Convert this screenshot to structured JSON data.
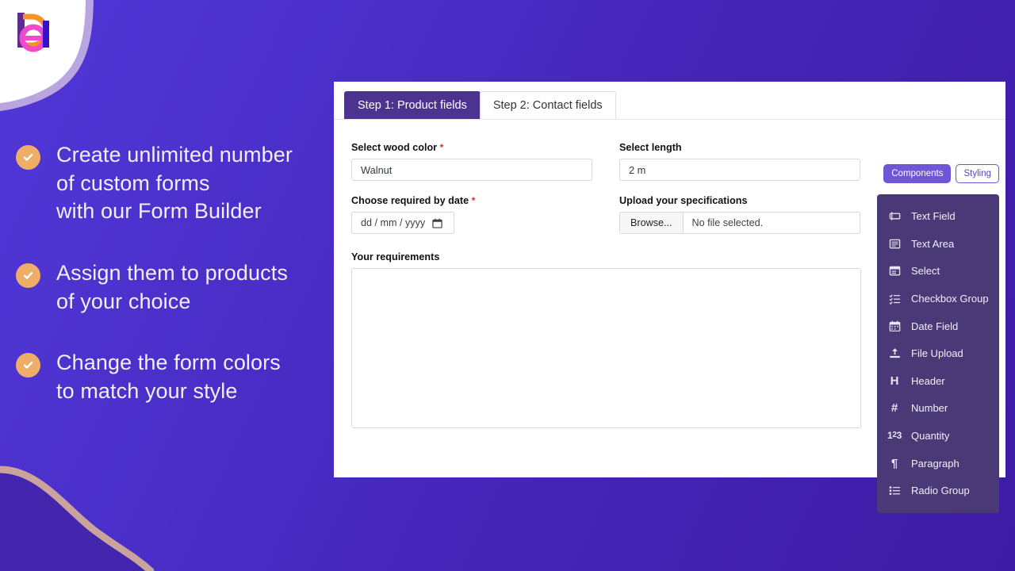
{
  "brand": {
    "logo_name": "delirium-logo",
    "colors": {
      "bg_gradient_start": "#5138d8",
      "bg_gradient_end": "#3d1ba4",
      "accent_orange": "#eeae67",
      "accent_purple": "#6f56d6",
      "panel_dark": "#493a77",
      "tab_active": "#4c3390",
      "required_red": "#d93025",
      "curve_tan": "#c9a39c",
      "curve_lavender": "#b9a5e0"
    }
  },
  "promo": {
    "bullets": [
      {
        "icon": "check-circle-icon",
        "text": "Create unlimited number\nof custom forms\nwith our Form Builder"
      },
      {
        "icon": "check-circle-icon",
        "text": "Assign them to products\nof your choice"
      },
      {
        "icon": "check-circle-icon",
        "text": "Change the form colors\nto match your style"
      }
    ]
  },
  "builder": {
    "tabs": [
      {
        "label": "Step 1: Product fields",
        "active": true
      },
      {
        "label": "Step 2: Contact fields",
        "active": false
      }
    ],
    "fields": {
      "wood_color": {
        "label": "Select wood color",
        "required": true,
        "required_mark": "*",
        "value": "Walnut"
      },
      "length": {
        "label": "Select length",
        "required": false,
        "value": "2 m"
      },
      "date": {
        "label": "Choose required by date",
        "required": true,
        "required_mark": "*",
        "placeholder": "dd / mm / yyyy",
        "icon": "calendar-icon"
      },
      "upload": {
        "label": "Upload your specifications",
        "required": false,
        "button_label": "Browse...",
        "file_status": "No file selected."
      },
      "requirements": {
        "label": "Your requirements",
        "required": false,
        "value": ""
      }
    },
    "rail": {
      "toggle": [
        {
          "label": "Components",
          "active": true
        },
        {
          "label": "Styling",
          "active": false
        }
      ],
      "components": [
        {
          "label": "Text Field",
          "icon": "text-field-icon"
        },
        {
          "label": "Text Area",
          "icon": "text-area-icon"
        },
        {
          "label": "Select",
          "icon": "select-icon"
        },
        {
          "label": "Checkbox Group",
          "icon": "checkbox-group-icon"
        },
        {
          "label": "Date Field",
          "icon": "calendar-icon"
        },
        {
          "label": "File Upload",
          "icon": "file-upload-icon"
        },
        {
          "label": "Header",
          "icon": "header-h-icon"
        },
        {
          "label": "Number",
          "icon": "hash-icon"
        },
        {
          "label": "Quantity",
          "icon": "quantity-123-icon"
        },
        {
          "label": "Paragraph",
          "icon": "pilcrow-icon"
        },
        {
          "label": "Radio Group",
          "icon": "radio-group-icon"
        }
      ]
    }
  }
}
